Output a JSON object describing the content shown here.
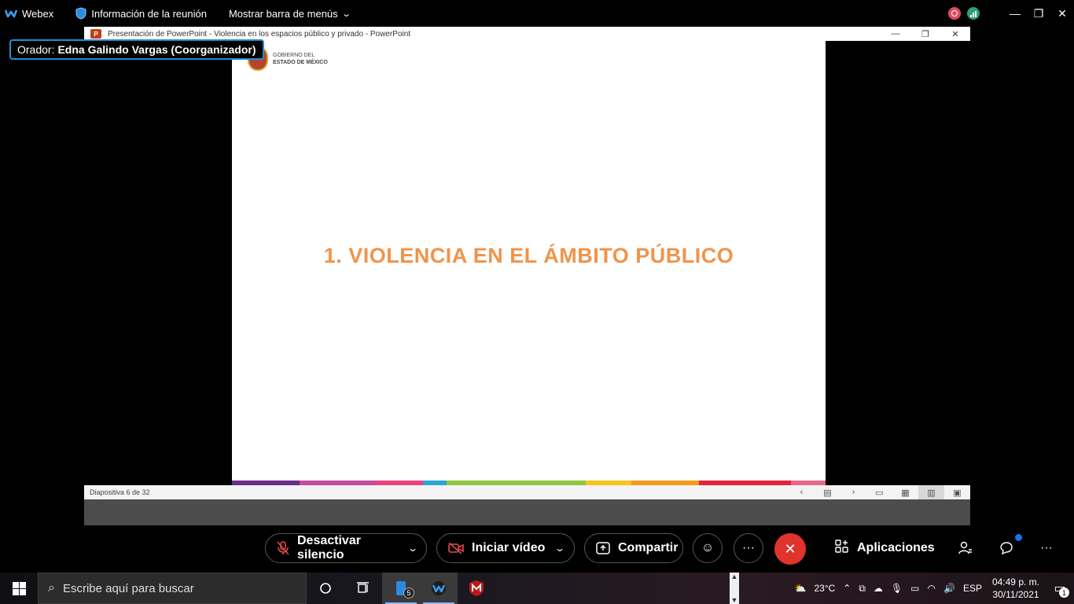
{
  "webex_bar": {
    "app_name": "Webex",
    "meeting_info": "Información de la reunión",
    "show_menu": "Mostrar barra de menús"
  },
  "speaker": {
    "prefix": "Orador:",
    "name": "Edna Galindo Vargas (Coorganizador)"
  },
  "ppt_window": {
    "title": "Presentación de PowerPoint  -  Violencia en los espacios público y privado - PowerPoint",
    "icon_label": "P"
  },
  "slide": {
    "logo_line1": "GOBIERNO DEL",
    "logo_line2": "ESTADO DE MÉXICO",
    "title": "1. VIOLENCIA EN EL ÁMBITO PÚBLICO",
    "title_color": "#f0944b",
    "stripe_colors": [
      "#6b2d8a",
      "#c44e9e",
      "#e8437f",
      "#2aa3d8",
      "#8ec63f",
      "#f7c51e",
      "#f39b1d",
      "#e2243c",
      "#e86a8a"
    ],
    "stripe_weights": [
      86,
      96,
      60,
      30,
      176,
      58,
      86,
      116,
      44
    ]
  },
  "ppt_status": {
    "slide_counter": "Diapositiva 6 de 32"
  },
  "controls": {
    "mute_label": "Desactivar silencio",
    "video_label": "Iniciar vídeo",
    "share_label": "Compartir",
    "apps_label": "Aplicaciones",
    "more_label": "···"
  },
  "taskbar": {
    "search_placeholder": "Escribe aquí para buscar",
    "app_badge": "5",
    "weather": "23°C",
    "language": "ESP",
    "time": "04:49 p. m.",
    "date": "30/11/2021",
    "notifications": "1"
  }
}
